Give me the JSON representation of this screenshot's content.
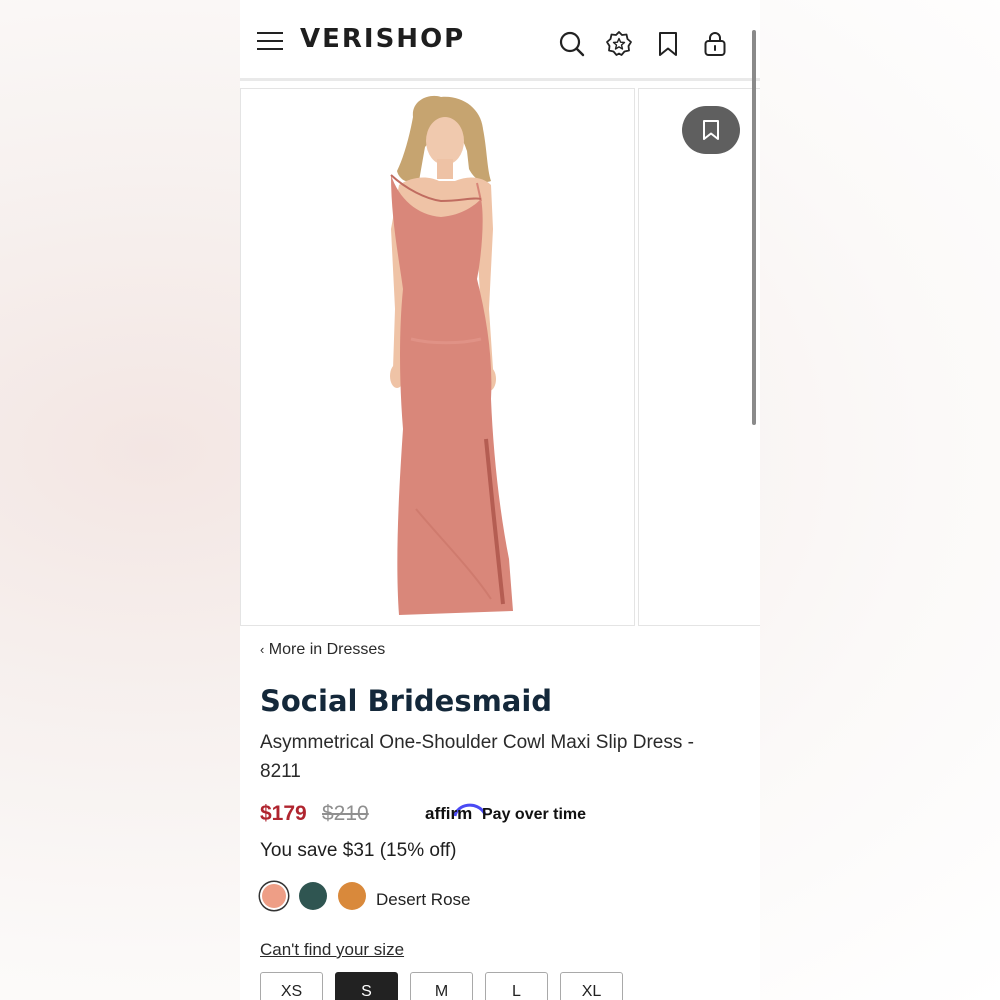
{
  "header": {
    "logo": "VERISHOP",
    "icons": [
      "menu-icon",
      "search-icon",
      "badge-star-icon",
      "bookmark-icon",
      "bag-icon"
    ]
  },
  "gallery": {
    "image_alt": "Model wearing a rose satin one-shoulder cowl maxi slip dress",
    "dress_color": "#d9877a",
    "save_icon": "bookmark-icon"
  },
  "breadcrumb": {
    "chevron": "‹",
    "label": "More in Dresses"
  },
  "product": {
    "brand": "Social Bridesmaid",
    "name": "Asymmetrical One-Shoulder Cowl Maxi Slip Dress - 8211",
    "price": "$179",
    "original_price": "$210",
    "affirm_logo": "affirm",
    "affirm_text": "Pay over time",
    "savings": "You save $31 (15% off)",
    "selected_color": "Desert Rose",
    "colors": [
      "#ee9e86",
      "#2f5551",
      "#d9893b"
    ],
    "size_link": "Can't find your size",
    "sizes": [
      "XS",
      "S",
      "M",
      "L",
      "XL"
    ],
    "selected_size": "S"
  },
  "theme": {
    "sale_red": "#b0252f",
    "brand_navy": "#14283a",
    "affirm_blue": "#4a4af4"
  }
}
